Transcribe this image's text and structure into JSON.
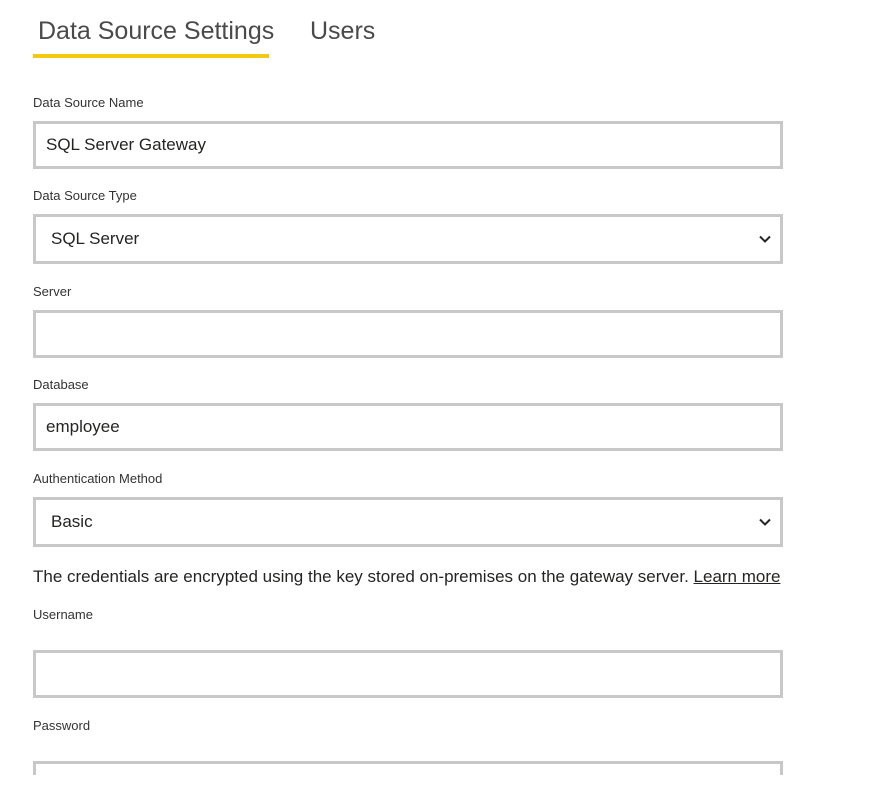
{
  "tabs": [
    {
      "label": "Data Source Settings",
      "active": true
    },
    {
      "label": "Users",
      "active": false
    }
  ],
  "accent_color": "#f2c811",
  "form": {
    "data_source_name": {
      "label": "Data Source Name",
      "value": "SQL Server Gateway"
    },
    "data_source_type": {
      "label": "Data Source Type",
      "value": "SQL Server",
      "icon": "chevron-down-icon"
    },
    "server": {
      "label": "Server",
      "value": ""
    },
    "database": {
      "label": "Database",
      "value": "employee"
    },
    "authentication_method": {
      "label": "Authentication Method",
      "value": "Basic",
      "icon": "chevron-down-icon"
    },
    "credentials_note": {
      "text": "The credentials are encrypted using the key stored on-premises on the gateway server.",
      "link": "Learn more"
    },
    "username": {
      "label": "Username",
      "value": ""
    },
    "password": {
      "label": "Password",
      "value": ""
    }
  }
}
